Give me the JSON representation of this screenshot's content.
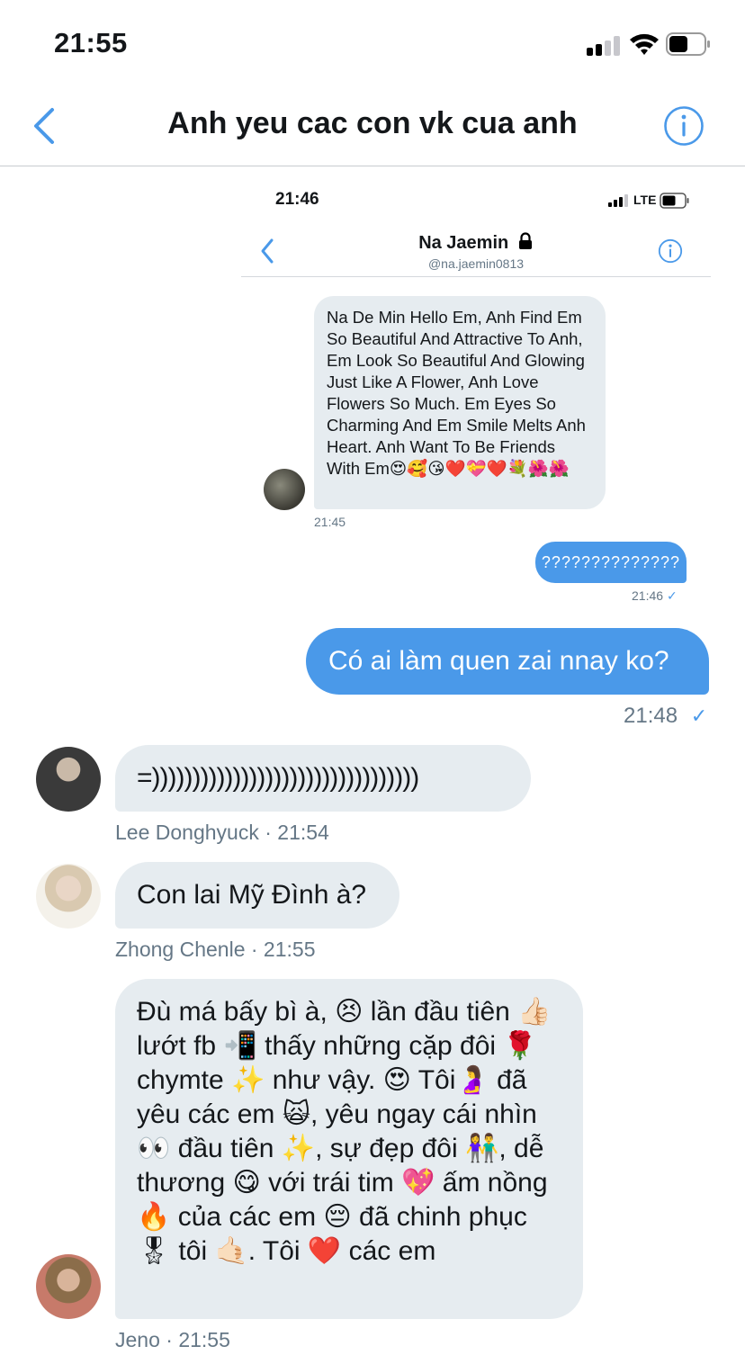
{
  "status_bar": {
    "time": "21:55"
  },
  "header": {
    "title": "Anh yeu cac con vk cua anh"
  },
  "embedded": {
    "time": "21:46",
    "network": "LTE",
    "name": "Na Jaemin",
    "handle": "@na.jaemin0813",
    "message": "Na De Min Hello Em, Anh Find Em So Beautiful And Attractive To Anh, Em Look So Beautiful And Glowing Just Like A Flower, Anh Love Flowers So Much. Em Eyes So Charming And Em Smile Melts Anh Heart. Anh Want To Be Friends With Em😍🥰😘❤️💝❤️💐🌺🌺",
    "message_time": "21:45",
    "reply": "??????????????",
    "reply_time": "21:46",
    "reply_check": "✓"
  },
  "outgoing": {
    "text": "Có ai làm quen zai nnay ko?",
    "time": "21:48",
    "check": "✓"
  },
  "incoming": [
    {
      "text": "=)))))))))))))))))))))))))))))))))",
      "sender": "Lee Donghyuck · 21:54"
    },
    {
      "text": "Con lai Mỹ Đình à?",
      "sender": "Zhong Chenle · 21:55"
    },
    {
      "text": "Đù má bấy bì à, 😣 lần đầu tiên 👍🏻 lướt fb 📲 thấy những cặp đôi 🌹 chymte ✨ như vậy. 😍 Tôi🤰 đã yêu các em 🙀, yêu ngay cái nhìn 👀 đầu tiên ✨, sự đẹp đôi 👫, dễ thương 😋 với trái tim 💖 ấm nồng 🔥 của các em 😔 đã chinh phục 🎖 tôi 🤙🏻. Tôi ❤️ các em",
      "sender": "Jeno · 21:55"
    }
  ],
  "colors": {
    "accent": "#4a99e9",
    "incoming_bubble": "#e6ecf0",
    "meta_text": "#657786"
  },
  "icons": [
    "back-chevron-icon",
    "info-icon",
    "lock-icon",
    "signal-icon",
    "wifi-icon",
    "battery-icon"
  ]
}
